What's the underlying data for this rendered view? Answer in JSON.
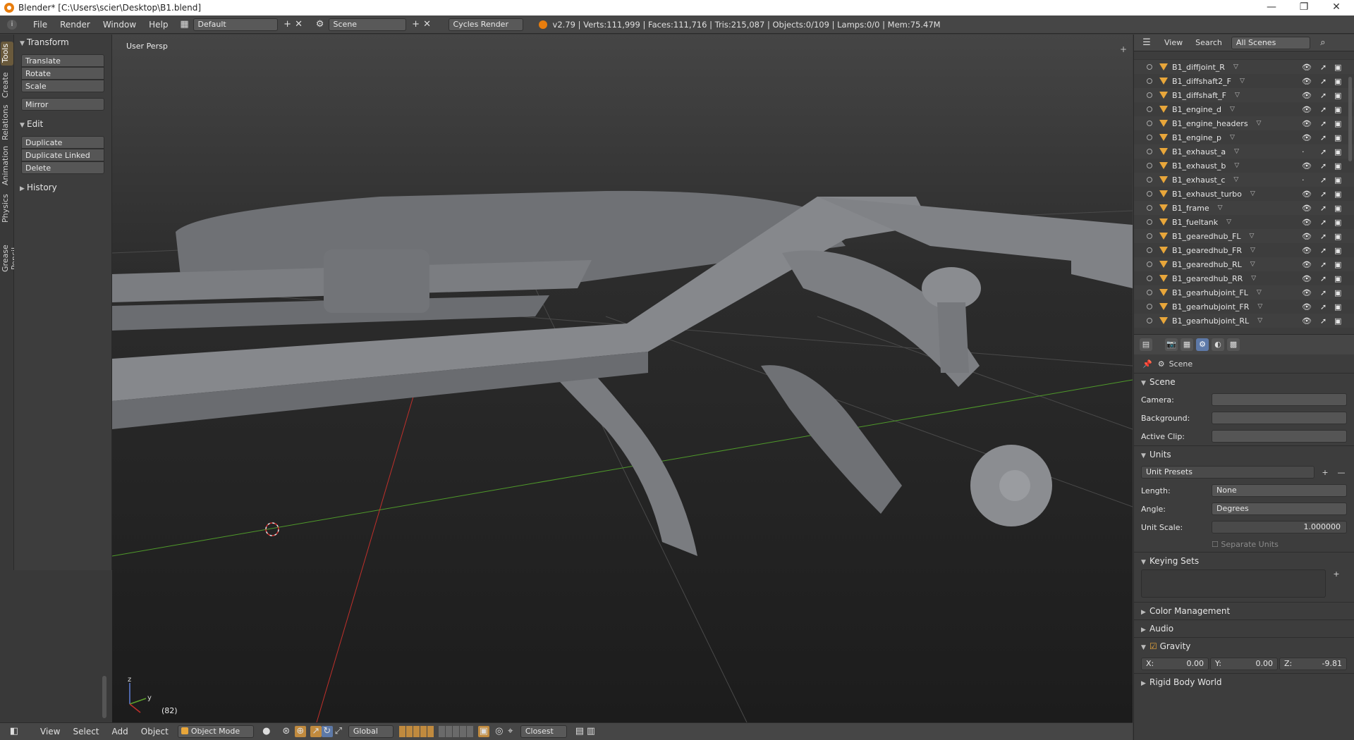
{
  "window": {
    "title": "Blender* [C:\\Users\\scier\\Desktop\\B1.blend]",
    "minimize": "—",
    "maximize": "❐",
    "close": "✕"
  },
  "topbar": {
    "info_icon": "i",
    "menu": [
      "File",
      "Render",
      "Window",
      "Help"
    ],
    "screen_layout": "Default",
    "scene": "Scene",
    "engine": "Cycles Render",
    "stats": "v2.79 | Verts:111,999 | Faces:111,716 | Tris:215,087 | Objects:0/109 | Lamps:0/0 | Mem:75.47M"
  },
  "tabs": [
    "Tools",
    "Create",
    "Relations",
    "Animation",
    "Physics",
    "Grease Pencil"
  ],
  "toolshelf": {
    "transform_title": "Transform",
    "transform_tools": [
      "Translate",
      "Rotate",
      "Scale"
    ],
    "mirror": "Mirror",
    "edit_title": "Edit",
    "edit_tools": [
      "Duplicate",
      "Duplicate Linked",
      "Delete"
    ],
    "history_title": "History"
  },
  "viewport": {
    "view_label": "User Persp",
    "frame_label": "(82)",
    "axis_z": "z",
    "axis_y": "y"
  },
  "header3d": {
    "menu": [
      "View",
      "Select",
      "Add",
      "Object"
    ],
    "mode": "Object Mode",
    "orientation": "Global",
    "snap": "Closest"
  },
  "outliner": {
    "view_menu": "View",
    "search_menu": "Search",
    "filter": "All Scenes",
    "rows": [
      "B1_diffjoint_R",
      "B1_diffshaft2_F",
      "B1_diffshaft_F",
      "B1_engine_d",
      "B1_engine_headers",
      "B1_engine_p",
      "B1_exhaust_a",
      "B1_exhaust_b",
      "B1_exhaust_c",
      "B1_exhaust_turbo",
      "B1_frame",
      "B1_fueltank",
      "B1_gearedhub_FL",
      "B1_gearedhub_FR",
      "B1_gearedhub_RL",
      "B1_gearedhub_RR",
      "B1_gearhubjoint_FL",
      "B1_gearhubjoint_FR",
      "B1_gearhubjoint_RL"
    ]
  },
  "properties": {
    "breadcrumb": "Scene",
    "scene_section": "Scene",
    "camera_label": "Camera:",
    "background_label": "Background:",
    "active_clip_label": "Active Clip:",
    "units_section": "Units",
    "unit_presets": "Unit Presets",
    "length_label": "Length:",
    "length_value": "None",
    "angle_label": "Angle:",
    "angle_value": "Degrees",
    "unit_scale_label": "Unit Scale:",
    "unit_scale_value": "1.000000",
    "separate_units": "Separate Units",
    "keying_sets_section": "Keying Sets",
    "color_management_section": "Color Management",
    "audio_section": "Audio",
    "gravity_section": "Gravity",
    "gravity_x_label": "X:",
    "gravity_x": "0.00",
    "gravity_y_label": "Y:",
    "gravity_y": "0.00",
    "gravity_z_label": "Z:",
    "gravity_z": "-9.81",
    "rigid_body_section": "Rigid Body World"
  },
  "colors": {
    "accent_orange": "#e87d0d",
    "selected_tab_blue": "#5d79a8",
    "x_axis": "#c0302b",
    "y_axis": "#5ea12d"
  }
}
